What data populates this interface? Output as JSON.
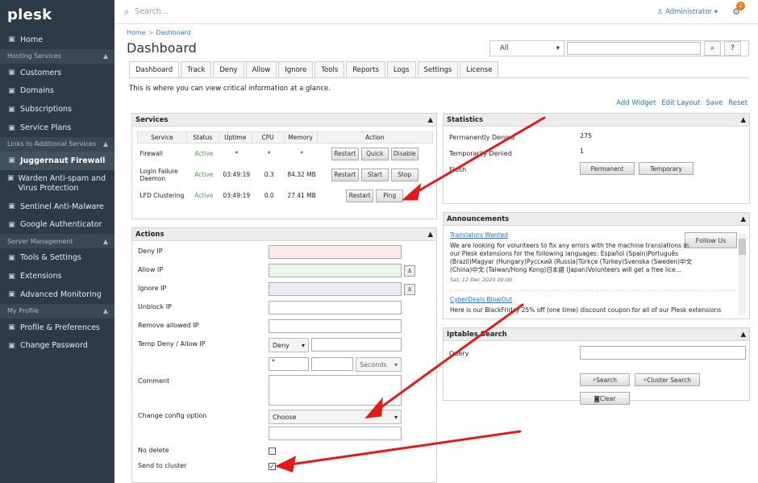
{
  "sidebar": {
    "logo": "plesk",
    "items": [
      {
        "label": "Home",
        "icon": "home-icon",
        "type": "item"
      },
      {
        "label": "Hosting Services",
        "type": "section"
      },
      {
        "label": "Customers",
        "icon": "user-icon",
        "type": "item"
      },
      {
        "label": "Domains",
        "icon": "globe-icon",
        "type": "item"
      },
      {
        "label": "Subscriptions",
        "icon": "subscriptions-icon",
        "type": "item"
      },
      {
        "label": "Service Plans",
        "icon": "plans-icon",
        "type": "item"
      },
      {
        "label": "Links to Additional Services",
        "type": "section"
      },
      {
        "label": "Juggernaut Firewall",
        "icon": "shield-icon",
        "type": "item",
        "active": true
      },
      {
        "label": "Warden Anti-spam and Virus Protection",
        "icon": "warden-icon",
        "type": "item"
      },
      {
        "label": "Sentinel Anti-Malware",
        "icon": "sentinel-icon",
        "type": "item"
      },
      {
        "label": "Google Authenticator",
        "icon": "google-icon",
        "type": "item"
      },
      {
        "label": "Server Management",
        "type": "section"
      },
      {
        "label": "Tools & Settings",
        "icon": "tools-icon",
        "type": "item"
      },
      {
        "label": "Extensions",
        "icon": "extensions-icon",
        "type": "item"
      },
      {
        "label": "Advanced Monitoring",
        "icon": "monitoring-icon",
        "type": "item"
      },
      {
        "label": "My Profile",
        "type": "section"
      },
      {
        "label": "Profile & Preferences",
        "icon": "profile-icon",
        "type": "item"
      },
      {
        "label": "Change Password",
        "icon": "key-icon",
        "type": "item"
      }
    ]
  },
  "topbar": {
    "search_placeholder": "Search...",
    "user": "Administrator",
    "notification_count": "2"
  },
  "breadcrumb": {
    "home": "Home",
    "dashboard": "Dashboard"
  },
  "page": {
    "title": "Dashboard",
    "filter_value": "All",
    "tabs": [
      "Dashboard",
      "Track",
      "Deny",
      "Allow",
      "Ignore",
      "Tools",
      "Reports",
      "Logs",
      "Settings",
      "License"
    ],
    "intro": "This is where you can view critical information at a glance.",
    "actions": [
      "Add Widget",
      "Edit Layout",
      "Save",
      "Reset"
    ]
  },
  "services": {
    "title": "Services",
    "headers": [
      "Service",
      "Status",
      "Uptime",
      "CPU",
      "Memory",
      "Action"
    ],
    "rows": [
      {
        "service": "Firewall",
        "status": "Active",
        "uptime": "*",
        "cpu": "*",
        "memory": "*",
        "buttons": [
          "Restart",
          "Quick",
          "Disable"
        ]
      },
      {
        "service": "Login Failure Daemon",
        "status": "Active",
        "uptime": "03:49:19",
        "cpu": "0.3",
        "memory": "84.32 MB",
        "buttons": [
          "Restart",
          "Start",
          "Stop"
        ]
      },
      {
        "service": "LFD Clustering",
        "status": "Active",
        "uptime": "03:49:19",
        "cpu": "0.0",
        "memory": "27.41 MB",
        "buttons": [
          "Restart",
          "Ping"
        ]
      }
    ]
  },
  "action_panel": {
    "title": "Actions",
    "labels": [
      "Deny IP",
      "Allow IP",
      "Ignore IP",
      "Unblock IP",
      "Remove allowed IP",
      "Temp Deny / Allow IP",
      "Comment",
      "Change config option",
      "No delete",
      "Send to cluster"
    ],
    "temp_select": "Deny",
    "temp_value": "*",
    "seconds": "Seconds",
    "choose": "Choose"
  },
  "statistics": {
    "title": "Statistics",
    "permanently_denied_label": "Permanently Denied",
    "permanently_denied": "275",
    "temporarily_denied_label": "Temporarily Denied",
    "temporarily_denied": "1",
    "flush_label": "Flush",
    "buttons": [
      "Permanent",
      "Temporary"
    ]
  },
  "announcements": {
    "title": "Announcements",
    "follow": "Follow Us",
    "items": [
      {
        "title": "Translators Wanted",
        "text": "We are looking for volunteers to fix any errors with the machine translations in our Plesk extensions for the following languages: Español (Spain)Português (Brazil)Magyar (Hungary)Русский (Russia)Türkçe (Turkey)Svenska (Sweden)中文 (China)中文 (Taiwan/Hong Kong)日本語 (Japan)Volunteers will get a free lice...",
        "date": "Sat, 12 Dec 2020 00:00"
      },
      {
        "title": "CyberDeals BlowOut",
        "text": "Here is our BlackFriday 25% off (one time) discount coupon for all of our Plesk extensions"
      }
    ]
  },
  "iptables": {
    "title": "Iptables Search",
    "query": "Query",
    "search": "Search",
    "cluster": "Cluster Search",
    "clear": "Clear"
  }
}
